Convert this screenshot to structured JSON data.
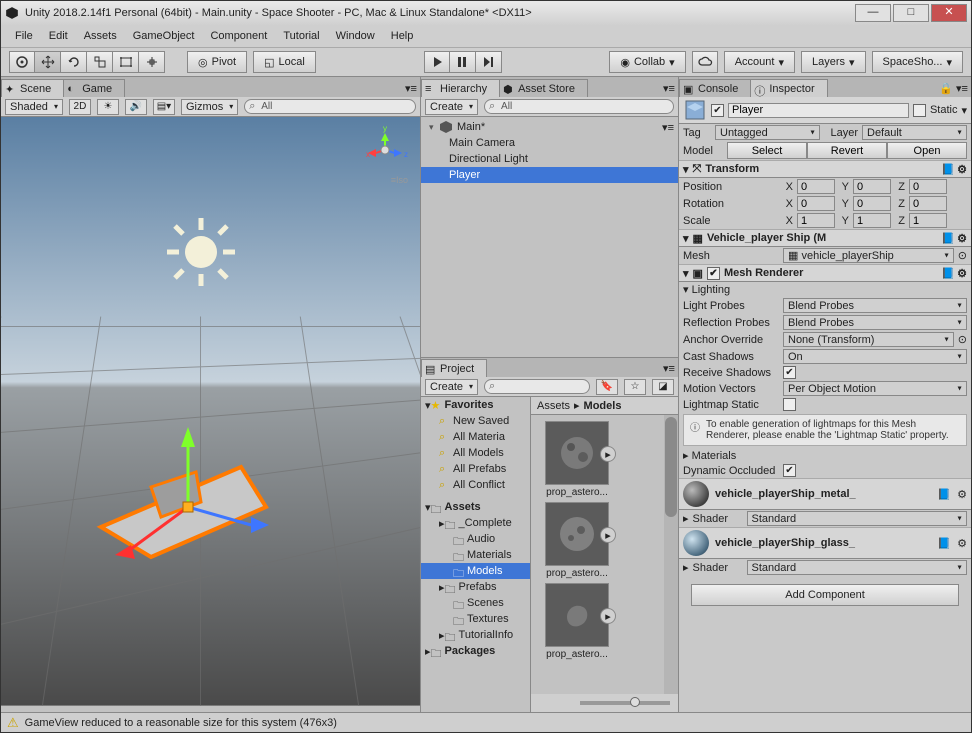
{
  "window": {
    "title": "Unity 2018.2.14f1 Personal (64bit) - Main.unity - Space Shooter - PC, Mac & Linux Standalone* <DX11>"
  },
  "menu": [
    "File",
    "Edit",
    "Assets",
    "GameObject",
    "Component",
    "Tutorial",
    "Window",
    "Help"
  ],
  "toolbar": {
    "pivot": "Pivot",
    "local": "Local",
    "collab": "Collab",
    "account": "Account",
    "layers": "Layers",
    "layout": "SpaceSho..."
  },
  "scene_tab": "Scene",
  "game_tab": "Game",
  "scene_toolbar": {
    "shaded": "Shaded",
    "mode2d": "2D",
    "gizmos": "Gizmos",
    "search": "All"
  },
  "scene_view": {
    "iso_label": "≡Iso"
  },
  "hierarchy": {
    "tab": "Hierarchy",
    "asset_store_tab": "Asset Store",
    "create": "Create",
    "search": "All",
    "root": "Main*",
    "children": [
      "Main Camera",
      "Directional Light",
      "Player"
    ],
    "selected_index": 2
  },
  "project": {
    "tab": "Project",
    "create": "Create",
    "favorites_label": "Favorites",
    "favorites": [
      "New Saved",
      "All Materia",
      "All Models",
      "All Prefabs",
      "All Conflict"
    ],
    "assets_label": "Assets",
    "packages_label": "Packages",
    "assets_folders": [
      "_Complete",
      "Audio",
      "Materials",
      "Models",
      "Prefabs",
      "Scenes",
      "Textures",
      "TutorialInfo"
    ],
    "selected_folder_index": 3,
    "breadcrumb": [
      "Assets",
      "Models"
    ],
    "items": [
      "prop_astero...",
      "prop_astero...",
      "prop_astero..."
    ]
  },
  "inspector": {
    "tab": "Inspector",
    "console_tab": "Console",
    "object_name": "Player",
    "static_label": "Static",
    "tag_label": "Tag",
    "tag_value": "Untagged",
    "layer_label": "Layer",
    "layer_value": "Default",
    "model_label": "Model",
    "select_btn": "Select",
    "revert_btn": "Revert",
    "open_btn": "Open",
    "transform": {
      "title": "Transform",
      "position_label": "Position",
      "rotation_label": "Rotation",
      "scale_label": "Scale",
      "pos": {
        "x": "0",
        "y": "0",
        "z": "0"
      },
      "rot": {
        "x": "0",
        "y": "0",
        "z": "0"
      },
      "scale": {
        "x": "1",
        "y": "1",
        "z": "1"
      }
    },
    "meshfilter": {
      "title": "Vehicle_player Ship (M",
      "mesh_label": "Mesh",
      "mesh_value": "vehicle_playerShip"
    },
    "renderer": {
      "title": "Mesh Renderer",
      "lighting": "Lighting",
      "light_probes_label": "Light Probes",
      "light_probes": "Blend Probes",
      "reflection_probes_label": "Reflection Probes",
      "reflection_probes": "Blend Probes",
      "anchor_override_label": "Anchor Override",
      "anchor_override": "None (Transform)",
      "cast_shadows_label": "Cast Shadows",
      "cast_shadows": "On",
      "receive_shadows_label": "Receive Shadows",
      "motion_vectors_label": "Motion Vectors",
      "motion_vectors": "Per Object Motion",
      "lightmap_static_label": "Lightmap Static",
      "help_text": "To enable generation of lightmaps for this Mesh Renderer, please enable the 'Lightmap Static' property.",
      "materials_label": "Materials",
      "dynamic_occluded_label": "Dynamic Occluded"
    },
    "materials": [
      {
        "name": "vehicle_playerShip_metal_",
        "shader_label": "Shader",
        "shader": "Standard"
      },
      {
        "name": "vehicle_playerShip_glass_",
        "shader_label": "Shader",
        "shader": "Standard"
      }
    ],
    "add_component": "Add Component"
  },
  "status": {
    "icon": "⚠",
    "text": "GameView reduced to a reasonable size for this system (476x3)"
  }
}
